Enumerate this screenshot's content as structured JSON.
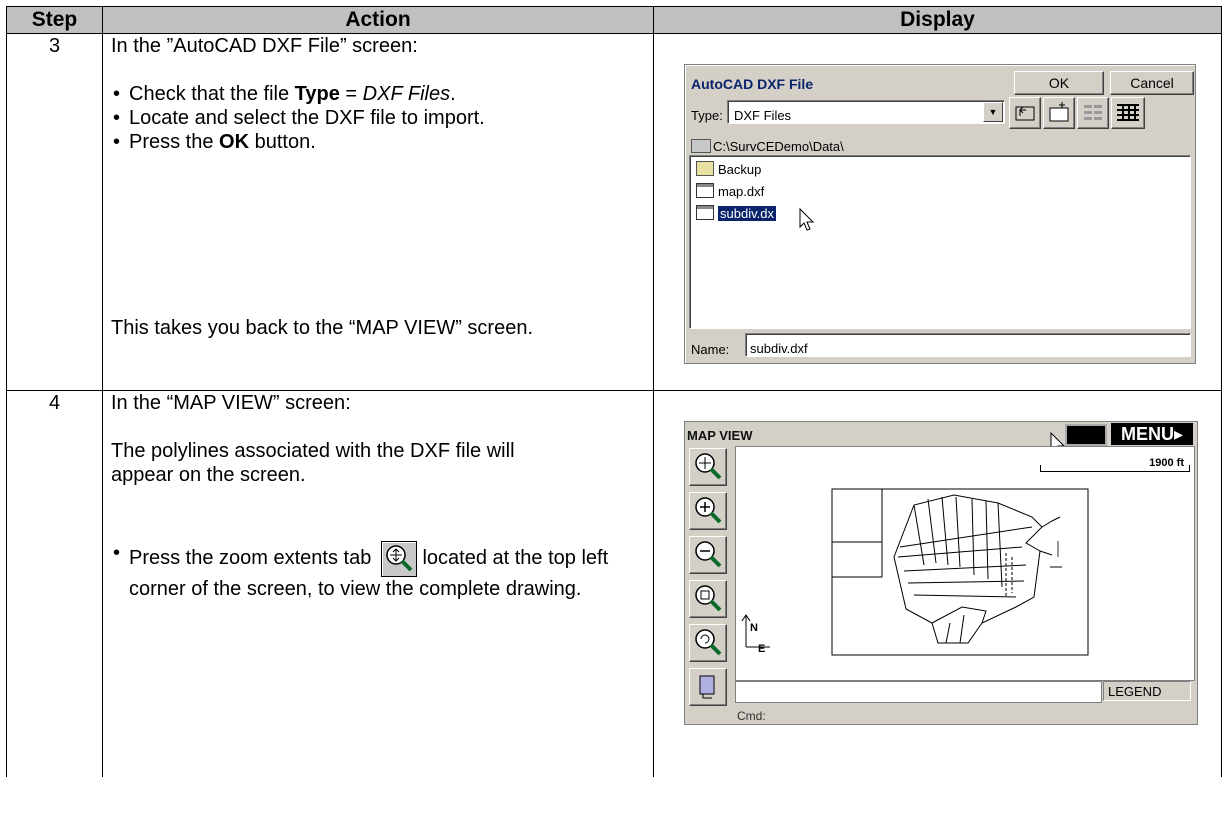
{
  "table": {
    "headers": {
      "step": "Step",
      "action": "Action",
      "display": "Display"
    },
    "rows": [
      {
        "step": "3",
        "intro": "In the ”AutoCAD DXF File” screen:",
        "bullets": [
          "Check that the file {b:Type} = {i:DXF Files}.",
          "Locate and select the DXF file to import.",
          "Press the {b:OK} button."
        ],
        "bullet_parts": [
          {
            "pre": "Check that the file ",
            "bold": "Type",
            "mid": " = ",
            "ital": "DXF Files",
            "post": "."
          },
          {
            "text": "Locate and select the DXF file to import."
          },
          {
            "pre": "Press the ",
            "bold": "OK",
            "post": " button."
          }
        ],
        "outro": "This takes you back to the “MAP VIEW” screen."
      },
      {
        "step": "4",
        "intro": "In the “MAP VIEW” screen:",
        "para": "The polylines associated with the DXF file will appear on the screen.",
        "bullet_pre": "Press the zoom extents tab",
        "bullet_post": "located at the top left corner of the screen, to view the complete drawing."
      }
    ]
  },
  "dialog": {
    "title": "AutoCAD DXF File",
    "ok_label": "OK",
    "cancel_label": "Cancel",
    "type_label": "Type:",
    "type_value": "DXF Files",
    "path": "C:\\SurvCEDemo\\Data\\",
    "files": [
      {
        "name": "Backup",
        "icon": "folder-icon"
      },
      {
        "name": "map.dxf",
        "icon": "dxf-file-icon"
      },
      {
        "name": "subdiv.dx",
        "icon": "dxf-file-icon",
        "selected": true
      }
    ],
    "name_label": "Name:",
    "name_value": "subdiv.dxf"
  },
  "mapview": {
    "title": "MAP VIEW",
    "menu_label": "MENU▸",
    "scale_text": "1900 ft",
    "legend_label": "LEGEND",
    "cmd_label": "Cmd:",
    "north_label": "N",
    "east_label": "E",
    "tools": [
      "zoom-extents-icon",
      "zoom-in-icon",
      "zoom-out-icon",
      "zoom-window-icon",
      "zoom-previous-icon",
      "pan-icon"
    ]
  }
}
